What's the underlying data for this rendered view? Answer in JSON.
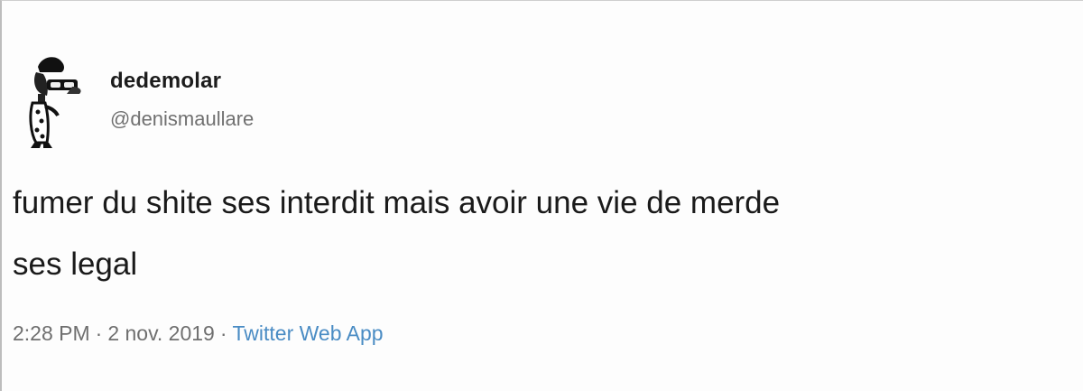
{
  "tweet": {
    "display_name": "dedemolar",
    "handle": "@denismaullare",
    "text_line1": "fumer du shite ses interdit mais avoir une vie de merde",
    "text_line2": "ses legal",
    "time": "2:28 PM",
    "separator": "·",
    "date": "2 nov. 2019",
    "source": "Twitter Web App",
    "avatar_icon": "cartoon-character-avatar-icon"
  },
  "colors": {
    "name": "#1c1c1c",
    "handle": "#707070",
    "text": "#1a1a1a",
    "meta": "#6f6f6f",
    "source_link": "#4a8cc4"
  }
}
